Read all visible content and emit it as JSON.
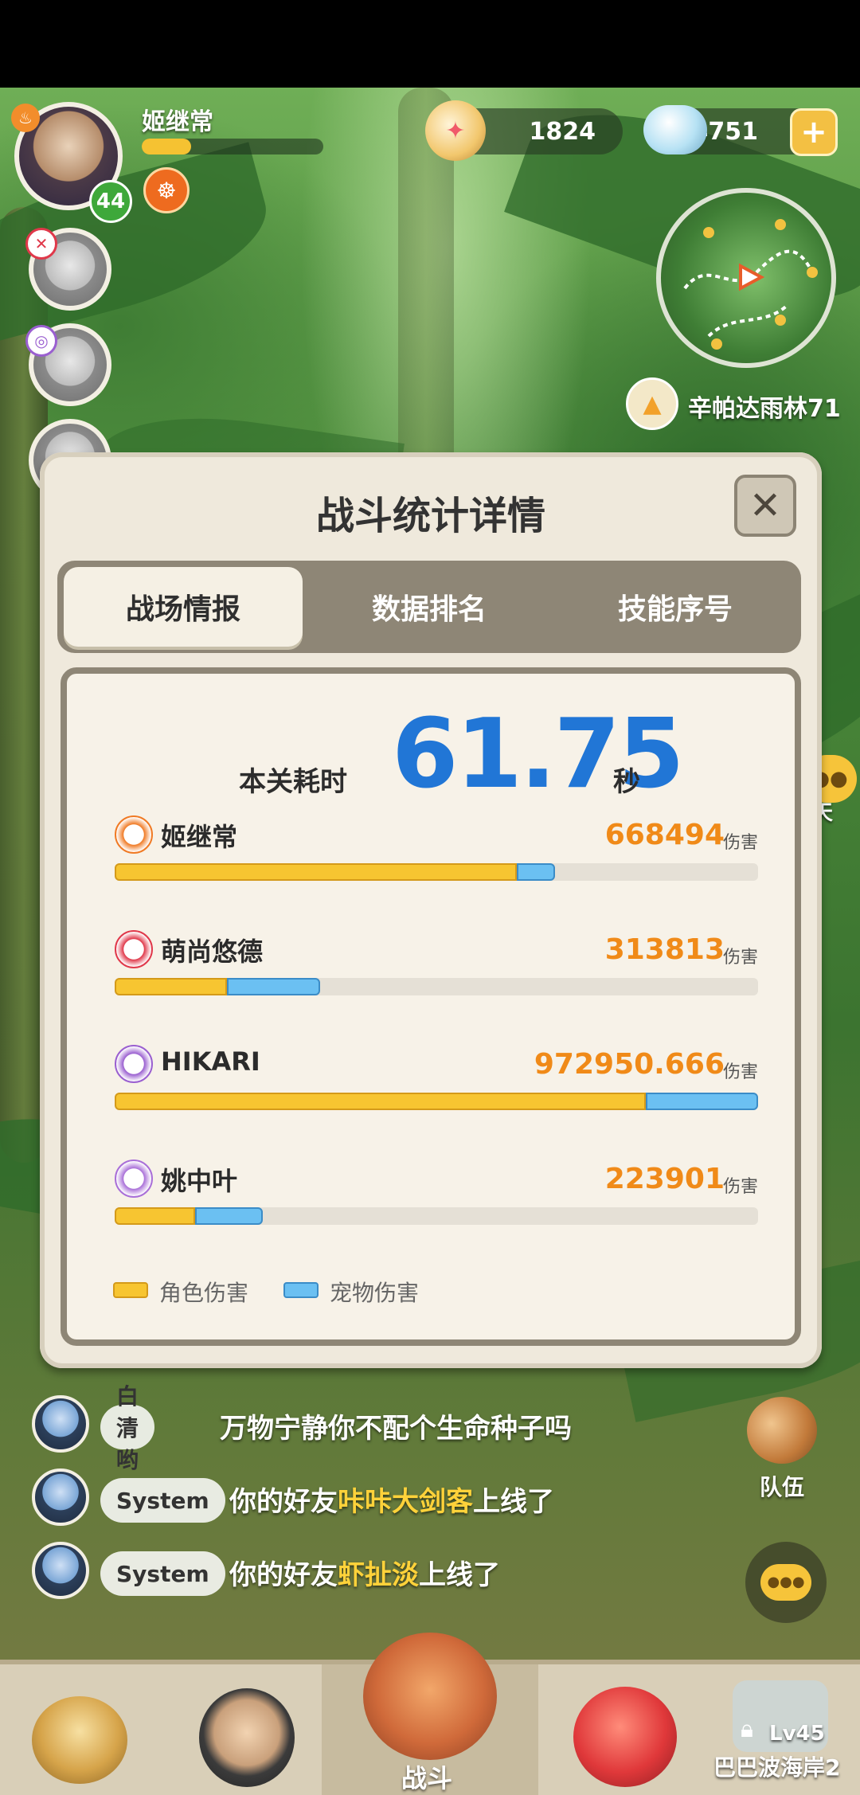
{
  "player": {
    "name": "姬继常",
    "level": "44"
  },
  "currency": {
    "pearls": "1824",
    "gems": "4751"
  },
  "location": "辛帕达雨林71",
  "side_chat_label": "聊天",
  "team_label": "队伍",
  "dialog": {
    "title": "战斗统计详情",
    "tabs": [
      {
        "label": "战场情报"
      },
      {
        "label": "数据排名"
      },
      {
        "label": "技能序号"
      }
    ],
    "time_label": "本关耗时",
    "time_value": "61.75",
    "time_unit": "秒",
    "damage_unit": "伤害",
    "rows": [
      {
        "name": "姬继常",
        "damage": "668494",
        "char_share": 0.625,
        "pet_share": 0.06,
        "icon_color": "#f07a24"
      },
      {
        "name": "萌尚悠德",
        "damage": "313813",
        "char_share": 0.175,
        "pet_share": 0.145,
        "icon_color": "#e0384a"
      },
      {
        "name": "HIKARI",
        "damage": "972950.666",
        "char_share": 0.825,
        "pet_share": 0.175,
        "icon_color": "#9a5fd0"
      },
      {
        "name": "姚中叶",
        "damage": "223901",
        "char_share": 0.125,
        "pet_share": 0.105,
        "icon_color": "#a96fd8"
      }
    ],
    "legend": {
      "char": "角色伤害",
      "pet": "宠物伤害"
    }
  },
  "chat": [
    {
      "tag": "白清哟",
      "pre": "万物宁静你不配个生命种子吗",
      "hl": "",
      "post": ""
    },
    {
      "tag": "System",
      "pre": "你的好友",
      "hl": "咔咔大剑客",
      "post": "上线了"
    },
    {
      "tag": "System",
      "pre": "你的好友",
      "hl": "虾扯淡",
      "post": "上线了"
    }
  ],
  "nav": {
    "battle_label": "战斗",
    "locked_level": "Lv45",
    "locked_name": "巴巴波海岸2"
  },
  "colors": {
    "char_bar": "#f7c531",
    "pet_bar": "#6bc0f2",
    "damage_text": "#f08a18",
    "time_text": "#2176d6"
  }
}
